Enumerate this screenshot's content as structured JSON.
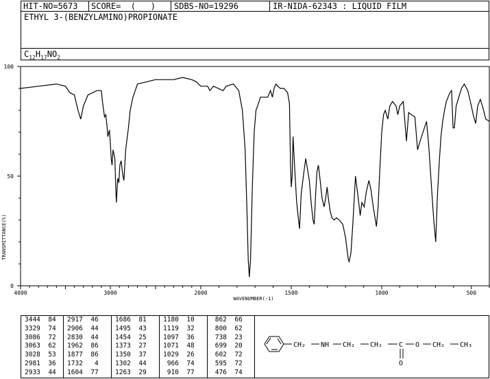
{
  "header": {
    "hit_no": "HIT-NO=5673",
    "score": "SCORE=  (   )",
    "sdbs_no": "SDBS-NO=19296",
    "ir_nida": "IR-NIDA-62343 : LIQUID FILM"
  },
  "compound_name": "ETHYL 3-(BENZYLAMINO)PROPIONATE",
  "formula": {
    "c": "C",
    "c_n": "12",
    "h": "H",
    "h_n": "17",
    "rest": "NO",
    "o_n": "2"
  },
  "chart_data": {
    "type": "line",
    "title": "",
    "xlabel": "WAVENUMBER(-1)",
    "ylabel": "TRANSMITTANCE(%)",
    "xlim": [
      4000,
      400
    ],
    "ylim": [
      0,
      100
    ],
    "x_ticks": [
      "4000",
      "3000",
      "2000",
      "1500",
      "1000",
      "500"
    ],
    "y_ticks": [
      "100",
      "50",
      "0"
    ],
    "series": [
      {
        "points": [
          [
            4000,
            90
          ],
          [
            3800,
            91
          ],
          [
            3600,
            92
          ],
          [
            3500,
            91
          ],
          [
            3450,
            88
          ],
          [
            3400,
            87
          ],
          [
            3360,
            80
          ],
          [
            3330,
            76
          ],
          [
            3300,
            82
          ],
          [
            3250,
            87
          ],
          [
            3200,
            88
          ],
          [
            3150,
            89
          ],
          [
            3100,
            89
          ],
          [
            3088,
            84
          ],
          [
            3065,
            77
          ],
          [
            3050,
            78
          ],
          [
            3035,
            72
          ],
          [
            3028,
            68
          ],
          [
            3010,
            71
          ],
          [
            3000,
            65
          ],
          [
            2990,
            58
          ],
          [
            2981,
            55
          ],
          [
            2970,
            62
          ],
          [
            2950,
            58
          ],
          [
            2940,
            45
          ],
          [
            2933,
            38
          ],
          [
            2920,
            48
          ],
          [
            2917,
            49
          ],
          [
            2906,
            47
          ],
          [
            2895,
            55
          ],
          [
            2880,
            57
          ],
          [
            2870,
            53
          ],
          [
            2860,
            50
          ],
          [
            2850,
            48
          ],
          [
            2840,
            55
          ],
          [
            2830,
            62
          ],
          [
            2800,
            72
          ],
          [
            2780,
            80
          ],
          [
            2750,
            86
          ],
          [
            2700,
            92
          ],
          [
            2600,
            93
          ],
          [
            2500,
            94
          ],
          [
            2400,
            94
          ],
          [
            2300,
            94
          ],
          [
            2200,
            95
          ],
          [
            2100,
            94
          ],
          [
            2050,
            93
          ],
          [
            2000,
            91
          ],
          [
            1962,
            91
          ],
          [
            1950,
            89
          ],
          [
            1930,
            91
          ],
          [
            1877,
            89
          ],
          [
            1860,
            91
          ],
          [
            1820,
            92
          ],
          [
            1790,
            89
          ],
          [
            1770,
            80
          ],
          [
            1755,
            62
          ],
          [
            1745,
            35
          ],
          [
            1738,
            12
          ],
          [
            1732,
            4
          ],
          [
            1725,
            12
          ],
          [
            1715,
            45
          ],
          [
            1705,
            70
          ],
          [
            1695,
            80
          ],
          [
            1686,
            82
          ],
          [
            1670,
            86
          ],
          [
            1650,
            86
          ],
          [
            1630,
            86
          ],
          [
            1615,
            89
          ],
          [
            1604,
            86
          ],
          [
            1595,
            90
          ],
          [
            1585,
            92
          ],
          [
            1575,
            91
          ],
          [
            1560,
            90
          ],
          [
            1540,
            90
          ],
          [
            1520,
            88
          ],
          [
            1510,
            83
          ],
          [
            1504,
            55
          ],
          [
            1500,
            45
          ],
          [
            1495,
            50
          ],
          [
            1490,
            68
          ],
          [
            1480,
            52
          ],
          [
            1470,
            38
          ],
          [
            1460,
            30
          ],
          [
            1454,
            26
          ],
          [
            1445,
            42
          ],
          [
            1430,
            52
          ],
          [
            1420,
            58
          ],
          [
            1410,
            53
          ],
          [
            1400,
            48
          ],
          [
            1390,
            38
          ],
          [
            1380,
            30
          ],
          [
            1373,
            28
          ],
          [
            1365,
            42
          ],
          [
            1358,
            52
          ],
          [
            1350,
            55
          ],
          [
            1340,
            48
          ],
          [
            1330,
            40
          ],
          [
            1318,
            36
          ],
          [
            1310,
            40
          ],
          [
            1302,
            45
          ],
          [
            1295,
            40
          ],
          [
            1285,
            34
          ],
          [
            1275,
            31
          ],
          [
            1263,
            30
          ],
          [
            1250,
            31
          ],
          [
            1235,
            30
          ],
          [
            1215,
            28
          ],
          [
            1200,
            22
          ],
          [
            1185,
            12
          ],
          [
            1180,
            11
          ],
          [
            1170,
            15
          ],
          [
            1160,
            28
          ],
          [
            1145,
            50
          ],
          [
            1130,
            40
          ],
          [
            1119,
            32
          ],
          [
            1110,
            38
          ],
          [
            1097,
            36
          ],
          [
            1085,
            43
          ],
          [
            1071,
            48
          ],
          [
            1060,
            44
          ],
          [
            1045,
            35
          ],
          [
            1035,
            30
          ],
          [
            1029,
            27
          ],
          [
            1020,
            36
          ],
          [
            1010,
            54
          ],
          [
            1000,
            70
          ],
          [
            990,
            78
          ],
          [
            980,
            80
          ],
          [
            966,
            76
          ],
          [
            955,
            82
          ],
          [
            940,
            84
          ],
          [
            920,
            82
          ],
          [
            910,
            78
          ],
          [
            900,
            82
          ],
          [
            880,
            84
          ],
          [
            862,
            66
          ],
          [
            850,
            79
          ],
          [
            835,
            78
          ],
          [
            815,
            77
          ],
          [
            800,
            62
          ],
          [
            790,
            65
          ],
          [
            770,
            70
          ],
          [
            750,
            75
          ],
          [
            738,
            64
          ],
          [
            725,
            48
          ],
          [
            710,
            30
          ],
          [
            699,
            20
          ],
          [
            690,
            40
          ],
          [
            680,
            55
          ],
          [
            670,
            68
          ],
          [
            660,
            75
          ],
          [
            650,
            80
          ],
          [
            640,
            84
          ],
          [
            620,
            88
          ],
          [
            610,
            89
          ],
          [
            602,
            72
          ],
          [
            595,
            72
          ],
          [
            585,
            82
          ],
          [
            570,
            86
          ],
          [
            555,
            90
          ],
          [
            540,
            92
          ],
          [
            520,
            89
          ],
          [
            500,
            82
          ],
          [
            490,
            78
          ],
          [
            476,
            74
          ],
          [
            465,
            82
          ],
          [
            450,
            85
          ],
          [
            435,
            81
          ],
          [
            420,
            76
          ],
          [
            400,
            75
          ]
        ]
      }
    ]
  },
  "peak_table": {
    "columns": [
      [
        [
          "3444",
          "84"
        ],
        [
          "3329",
          "74"
        ],
        [
          "3086",
          "72"
        ],
        [
          "3063",
          "62"
        ],
        [
          "3028",
          "53"
        ],
        [
          "2981",
          "36"
        ],
        [
          "2933",
          "44"
        ]
      ],
      [
        [
          "2917",
          "46"
        ],
        [
          "2906",
          "44"
        ],
        [
          "2830",
          "44"
        ],
        [
          "1962",
          "86"
        ],
        [
          "1877",
          "86"
        ],
        [
          "1732",
          "4"
        ],
        [
          "1604",
          "77"
        ]
      ],
      [
        [
          "1686",
          "81"
        ],
        [
          "1495",
          "43"
        ],
        [
          "1454",
          "25"
        ],
        [
          "1373",
          "27"
        ],
        [
          "1350",
          "37"
        ],
        [
          "1302",
          "44"
        ],
        [
          "1263",
          "29"
        ]
      ],
      [
        [
          "1180",
          "10"
        ],
        [
          "1119",
          "32"
        ],
        [
          "1097",
          "36"
        ],
        [
          "1071",
          "48"
        ],
        [
          "1029",
          "26"
        ],
        [
          "966",
          "74"
        ],
        [
          "910",
          "77"
        ]
      ],
      [
        [
          "862",
          "66"
        ],
        [
          "800",
          "62"
        ],
        [
          "738",
          "23"
        ],
        [
          "699",
          "20"
        ],
        [
          "602",
          "72"
        ],
        [
          "595",
          "72"
        ],
        [
          "476",
          "74"
        ]
      ]
    ]
  },
  "structure": {
    "ch2_a": "CH₂",
    "nh": "NH",
    "ch2_b": "CH₂",
    "ch2_c": "CH₂",
    "c": "C",
    "o_double": "O",
    "o_single": "O",
    "ch2_d": "CH₂",
    "ch3": "CH₃"
  }
}
